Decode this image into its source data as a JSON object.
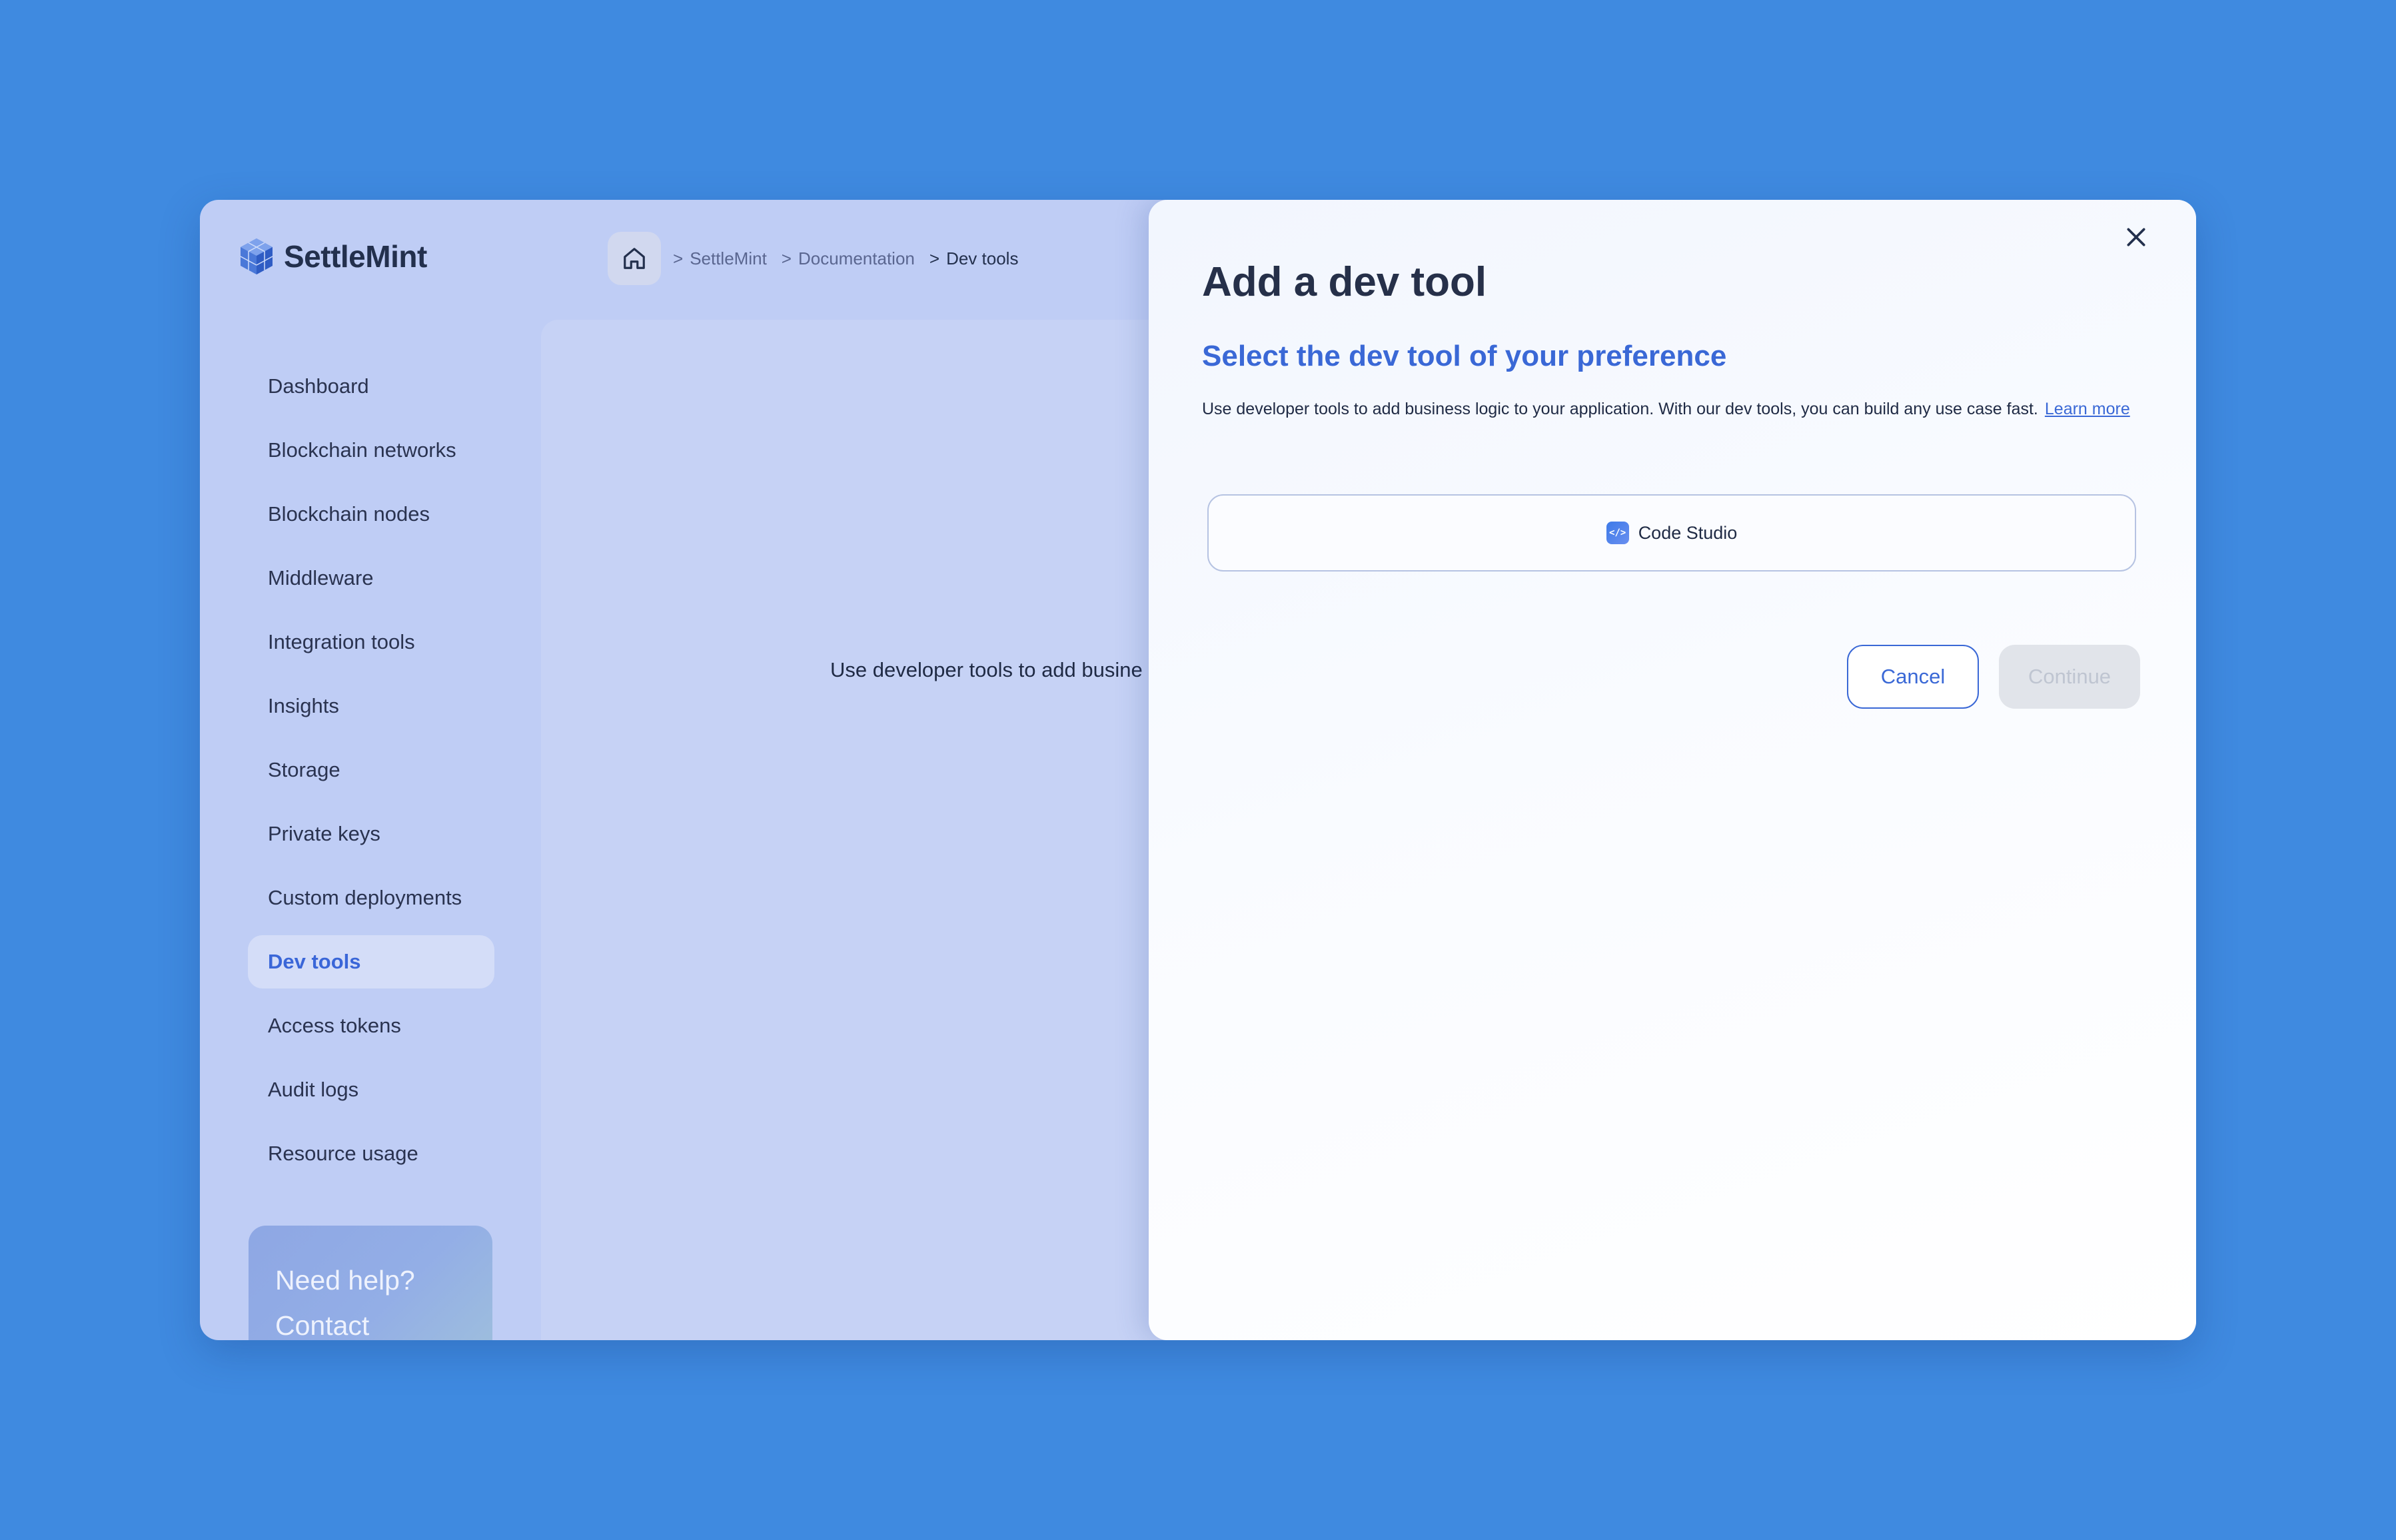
{
  "brand": {
    "name": "SettleMint"
  },
  "breadcrumb": {
    "items": [
      "SettleMint",
      "Documentation",
      "Dev tools"
    ],
    "separator": ">"
  },
  "sidebar": {
    "items": [
      {
        "label": "Dashboard",
        "active": false
      },
      {
        "label": "Blockchain networks",
        "active": false
      },
      {
        "label": "Blockchain nodes",
        "active": false
      },
      {
        "label": "Middleware",
        "active": false
      },
      {
        "label": "Integration tools",
        "active": false
      },
      {
        "label": "Insights",
        "active": false
      },
      {
        "label": "Storage",
        "active": false
      },
      {
        "label": "Private keys",
        "active": false
      },
      {
        "label": "Custom deployments",
        "active": false
      },
      {
        "label": "Dev tools",
        "active": true
      },
      {
        "label": "Access tokens",
        "active": false
      },
      {
        "label": "Audit logs",
        "active": false
      },
      {
        "label": "Resource usage",
        "active": false
      }
    ],
    "help_card": {
      "line1": "Need help?",
      "line2": "Contact"
    }
  },
  "main": {
    "text": "Use developer tools to add busine"
  },
  "drawer": {
    "title": "Add a dev tool",
    "subtitle": "Select the dev tool of your preference",
    "description": "Use developer tools to add business logic to your application. With our dev tools, you can build any use case fast.",
    "learn_more": "Learn more",
    "options": [
      {
        "label": "Code Studio",
        "icon": "code-icon"
      }
    ],
    "cancel_label": "Cancel",
    "continue_label": "Continue",
    "continue_disabled": true
  },
  "colors": {
    "background": "#3f8ae0",
    "accent": "#3a68d6",
    "active_nav_bg": "#d4ddf8"
  }
}
